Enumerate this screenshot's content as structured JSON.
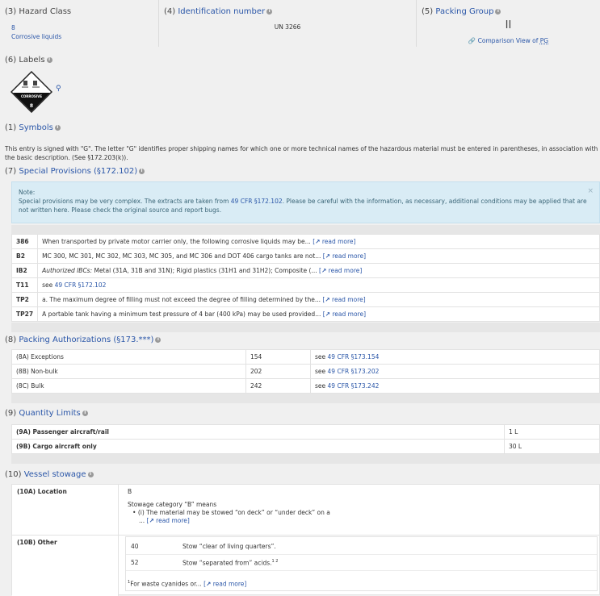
{
  "hazard_class": {
    "heading": "(3) Hazard Class",
    "class_number": "8",
    "class_name": "Corrosive liquids"
  },
  "identification": {
    "heading_prefix": "(4)",
    "heading_link": "Identification number",
    "value": "UN 3266"
  },
  "packing_group": {
    "heading_prefix": "(5)",
    "heading_link": "Packing Group",
    "value": "II",
    "comparison_link": "Comparison View of",
    "comparison_abbr": "PG"
  },
  "labels": {
    "heading": "(6) Labels",
    "diamond_text": "CORROSIVE",
    "diamond_number": "8"
  },
  "symbols": {
    "heading_prefix": "(1)",
    "heading_link": "Symbols",
    "text": "This entry is signed with \"G\". The letter \"G\" identifies proper shipping names for which one or more technical names of the hazardous material must be entered in parentheses, in association with the basic description. (See §172.203(k))."
  },
  "special_provisions": {
    "heading_prefix": "(7)",
    "heading_link": "Special Provisions (§172.102)",
    "note_title": "Note:",
    "note_pre": "Special provisions may be very complex. The extracts are taken from",
    "note_link": "49 CFR §172.102",
    "note_post": ". Please be careful with the information, as necessary, additional conditions may be applied that are not written here. Please check the original source and report bugs.",
    "note_close": "×",
    "read_more": "read more",
    "rows": [
      {
        "code": "386",
        "text": "When transported by private motor carrier only, the following corrosive liquids may be..."
      },
      {
        "code": "B2",
        "text": "MC 300, MC 301, MC 302, MC 303, MC 305, and MC 306 and DOT 406 cargo tanks are not..."
      },
      {
        "code": "IB2",
        "italic": "Authorized IBCs:",
        "text": " Metal (31A, 31B and 31N); Rigid plastics (31H1 and 31H2); Composite (..."
      },
      {
        "code": "T11",
        "see": "see",
        "link": "49 CFR §172.102"
      },
      {
        "code": "TP2",
        "text": "a. The maximum degree of filling must not exceed the degree of filling determined by the..."
      },
      {
        "code": "TP27",
        "text": "A portable tank having a minimum test pressure of 4 bar (400 kPa) may be used provided..."
      }
    ]
  },
  "packing_auth": {
    "heading_prefix": "(8)",
    "heading_link": "Packing Authorizations (§173.***)",
    "rows": [
      {
        "label": "(8A) Exceptions",
        "num": "154",
        "see": "see",
        "link": "49 CFR §173.154"
      },
      {
        "label": "(8B) Non-bulk",
        "num": "202",
        "see": "see",
        "link": "49 CFR §173.202"
      },
      {
        "label": "(8C) Bulk",
        "num": "242",
        "see": "see",
        "link": "49 CFR §173.242"
      }
    ]
  },
  "quantity": {
    "heading_prefix": "(9)",
    "heading_link": "Quantity Limits",
    "rows": [
      {
        "label": "(9A) Passenger aircraft/rail",
        "value": "1 L"
      },
      {
        "label": "(9B) Cargo aircraft only",
        "value": "30 L"
      }
    ]
  },
  "vessel": {
    "heading_prefix": "(10)",
    "heading_link": "Vessel stowage",
    "loc_label": "(10A) Location",
    "loc_value": "B",
    "stow_cat": "Stowage category “B” means",
    "bullet": "(i) The material may be stowed “on deck” or “under deck” on a",
    "bullet_cont": "...",
    "read_more": "read more",
    "other_label": "(10B) Other",
    "other_rows": [
      {
        "num": "40",
        "text": "Stow “clear of living quarters”.",
        "sup": ""
      },
      {
        "num": "52",
        "text": "Stow “separated from” acids.",
        "sup": "1 2"
      }
    ],
    "footnote_sup": "1",
    "footnote": "For waste cyanides or..."
  }
}
